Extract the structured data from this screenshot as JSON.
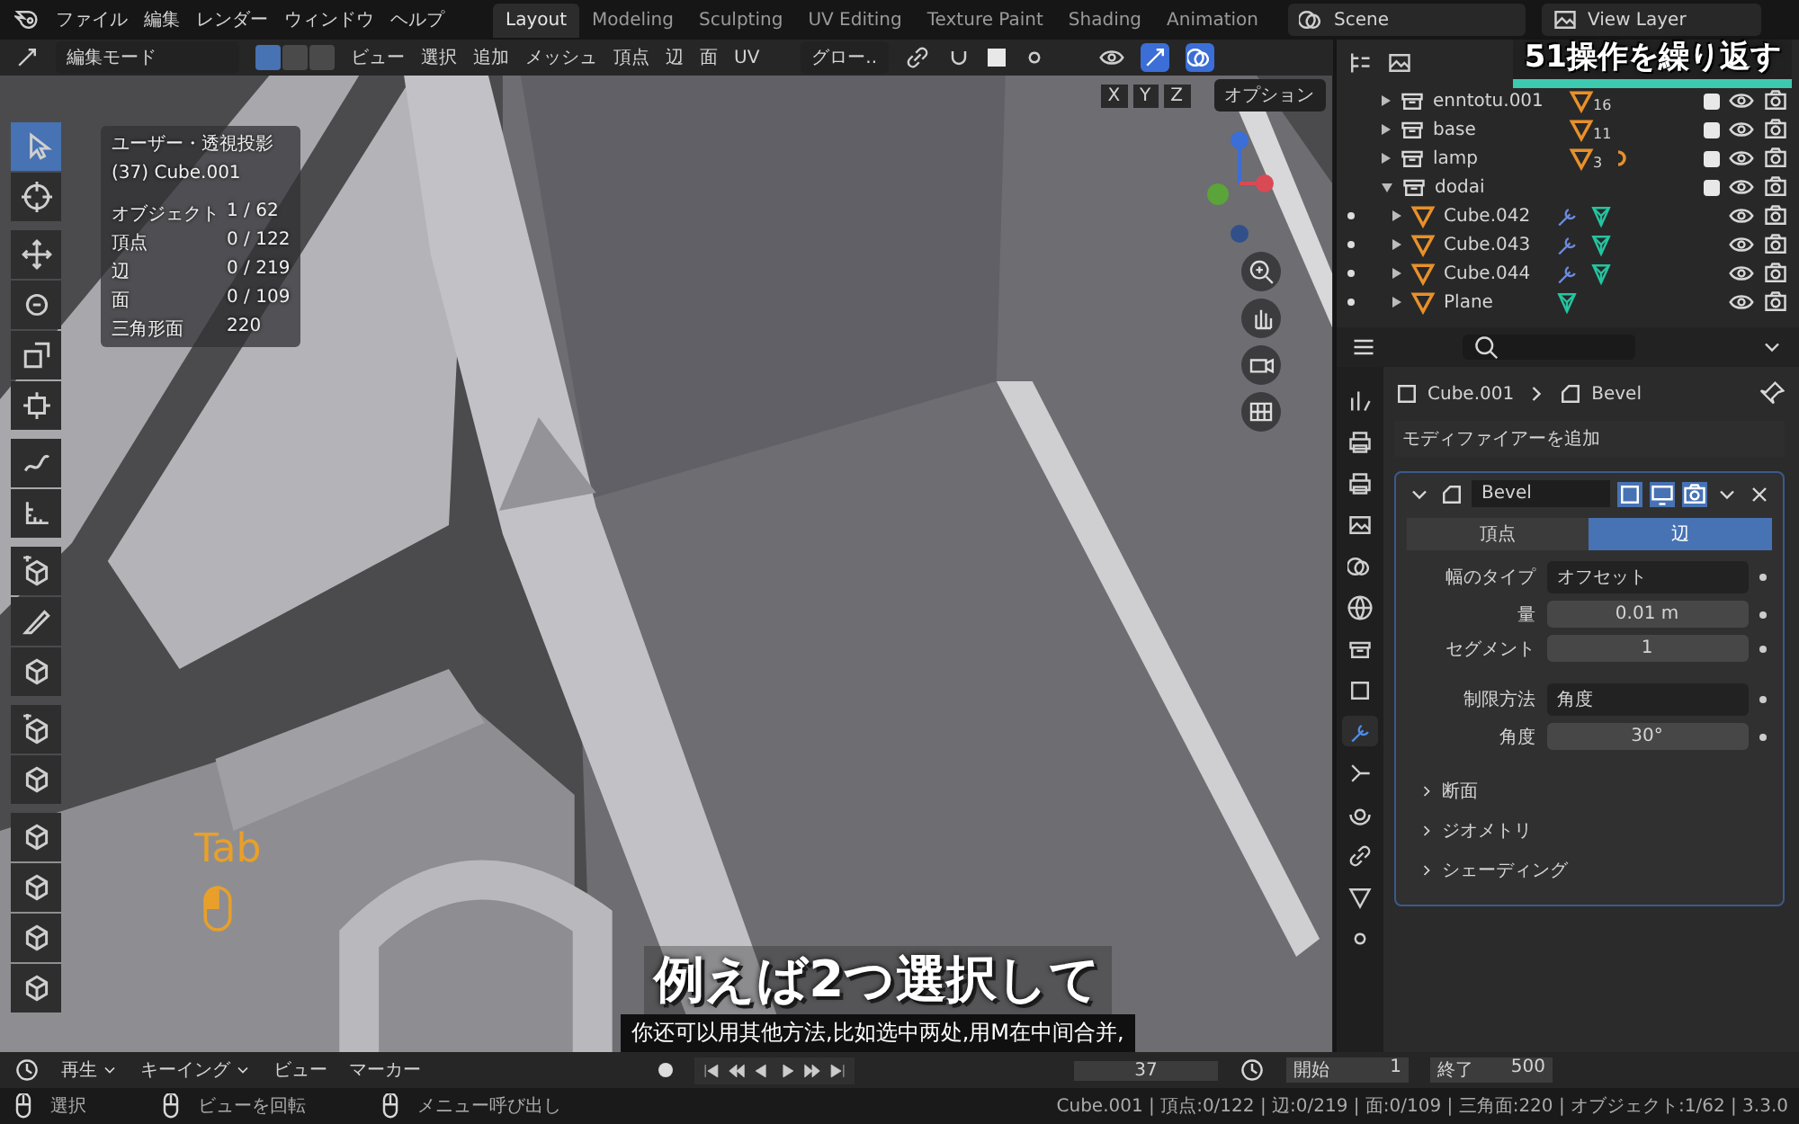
{
  "topbar": {
    "menus": [
      "ファイル",
      "編集",
      "レンダー",
      "ウィンドウ",
      "ヘルプ"
    ],
    "workspaces": [
      {
        "label": "Layout",
        "selected": true
      },
      {
        "label": "Modeling",
        "selected": false
      },
      {
        "label": "Sculpting",
        "selected": false
      },
      {
        "label": "UV Editing",
        "selected": false
      },
      {
        "label": "Texture Paint",
        "selected": false
      },
      {
        "label": "Shading",
        "selected": false
      },
      {
        "label": "Animation",
        "selected": false
      }
    ],
    "scene": "Scene",
    "view_layer": "View Layer"
  },
  "banner": "51操作を繰り返す",
  "viewport_header": {
    "mode": "編集モード",
    "select_modes": [
      {
        "selected": true
      },
      {
        "selected": false
      },
      {
        "selected": false
      }
    ],
    "menus": [
      "ビュー",
      "選択",
      "追加",
      "メッシュ",
      "頂点",
      "辺",
      "面",
      "UV"
    ],
    "orientation": "グロー.."
  },
  "tool_settings": {
    "axes": [
      {
        "label": "X",
        "selected": false
      },
      {
        "label": "Y",
        "selected": false
      },
      {
        "label": "Z",
        "selected": false
      }
    ],
    "options": "オプション"
  },
  "overlay_info": {
    "view": "ユーザー・透視投影",
    "object": "(37) Cube.001",
    "stats": [
      {
        "label": "オブジェクト",
        "value": "1 / 62"
      },
      {
        "label": "頂点",
        "value": "0 / 122"
      },
      {
        "label": "辺",
        "value": "0 / 219"
      },
      {
        "label": "面",
        "value": "0 / 109"
      },
      {
        "label": "三角形面",
        "value": "220"
      }
    ]
  },
  "tools": [
    {
      "selected": true
    },
    {
      "selected": false
    },
    {
      "selected": false
    },
    {
      "selected": false
    },
    {
      "selected": false
    },
    {
      "selected": false
    },
    {
      "selected": false
    },
    {
      "selected": false
    },
    {
      "selected": false
    },
    {
      "selected": false
    },
    {
      "selected": false
    },
    {
      "selected": false
    },
    {
      "selected": false
    },
    {
      "selected": false
    },
    {
      "selected": false
    },
    {
      "selected": false
    },
    {
      "selected": false
    }
  ],
  "key_overlay": {
    "key": "Tab"
  },
  "caption_jp": "例えば2つ選択して",
  "caption_zh": "你还可以用其他方法,比如选中两处,用M在中间合并,",
  "outliner": {
    "rows": [
      {
        "name": "enntotu.001",
        "count": "16",
        "expanded": false,
        "checked": true,
        "has_light": false
      },
      {
        "name": "base",
        "count": "11",
        "expanded": false,
        "checked": true,
        "has_light": false
      },
      {
        "name": "lamp",
        "count": "3",
        "expanded": false,
        "checked": true,
        "has_light": true
      },
      {
        "name": "dodai",
        "expanded": true,
        "checked": true,
        "has_light": false,
        "children": [
          {
            "name": "Cube.042",
            "has_modifier": true
          },
          {
            "name": "Cube.043",
            "has_modifier": true
          },
          {
            "name": "Cube.044",
            "has_modifier": true
          },
          {
            "name": "Plane",
            "has_modifier": false
          }
        ]
      }
    ]
  },
  "properties": {
    "tabs": [
      {
        "selected": false
      },
      {
        "selected": false
      },
      {
        "selected": false
      },
      {
        "selected": false
      },
      {
        "selected": false
      },
      {
        "selected": false
      },
      {
        "selected": false
      },
      {
        "selected": false
      },
      {
        "selected": true
      },
      {
        "selected": false
      },
      {
        "selected": false
      },
      {
        "selected": false
      },
      {
        "selected": false
      },
      {
        "selected": false
      }
    ],
    "breadcrumb": [
      "Cube.001",
      "Bevel"
    ],
    "add_modifier": "モディファイアーを追加",
    "modifier": {
      "name": "Bevel",
      "expanded": true,
      "affect": [
        {
          "label": "頂点",
          "selected": false
        },
        {
          "label": "辺",
          "selected": true
        }
      ],
      "field_groups": [
        [
          {
            "label": "幅のタイプ",
            "value": "オフセット",
            "kind": "dropdown"
          },
          {
            "label": "量",
            "value": "0.01 m",
            "kind": "number"
          },
          {
            "label": "セグメント",
            "value": "1",
            "kind": "number"
          }
        ],
        [
          {
            "label": "制限方法",
            "value": "角度",
            "kind": "dropdown"
          },
          {
            "label": "角度",
            "value": "30°",
            "kind": "number"
          }
        ]
      ],
      "subpanels": [
        {
          "label": "断面",
          "expanded": false
        },
        {
          "label": "ジオメトリ",
          "expanded": false
        },
        {
          "label": "シェーディング",
          "expanded": false
        }
      ]
    }
  },
  "timeline": {
    "menus": [
      {
        "label": "再生",
        "dropdown": true
      },
      {
        "label": "キーイング",
        "dropdown": true
      },
      {
        "label": "ビュー",
        "dropdown": false
      },
      {
        "label": "マーカー",
        "dropdown": false
      }
    ],
    "current_frame": "37",
    "start_label": "開始",
    "start": "1",
    "end_label": "終了",
    "end": "500"
  },
  "status_bar": {
    "hints": [
      "選択",
      "ビューを回転",
      "メニュー呼び出し"
    ],
    "info": "Cube.001 | 頂点:0/122 | 辺:0/219 | 面:0/109 | 三角面:220 | オブジェクト:1/62 | 3.3.0"
  }
}
